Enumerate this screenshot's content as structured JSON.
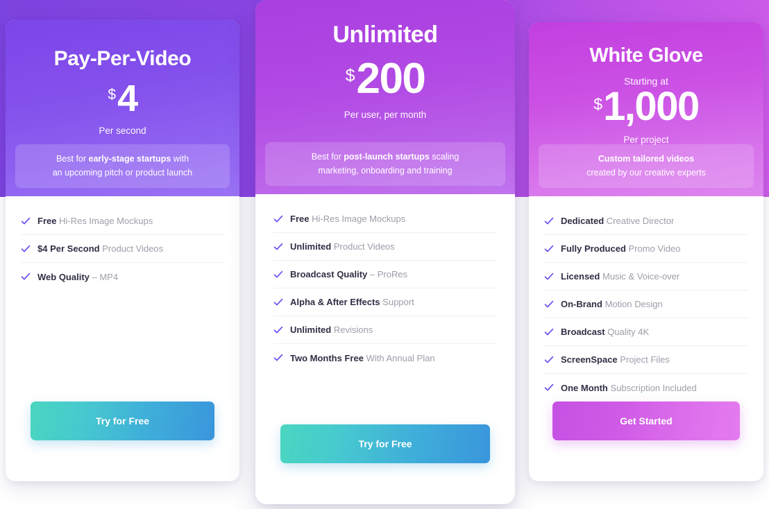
{
  "theme": {
    "band_color": "#8a45e2",
    "check_color": "#6c4bf0",
    "feature_strong_color": "#2f2f45",
    "feature_muted_color": "#9d9dab",
    "cta_teal_from": "#4ad6c0",
    "cta_teal_to": "#3a95dc",
    "cta_pink_from": "#c551e4",
    "cta_pink_to": "#e47bef"
  },
  "plans": [
    {
      "id": "pay-per-video",
      "name": "Pay-Per-Video",
      "starting_at": "",
      "currency": "$",
      "amount": "4",
      "price_sub": "Per second",
      "best_for_pre": "Best for ",
      "best_for_bold": "early-stage startups",
      "best_for_post": " with",
      "best_for_line2": "an upcoming pitch or product launch",
      "features": [
        {
          "strong": "Free",
          "rest": "Hi-Res Image Mockups"
        },
        {
          "strong": "$4 Per Second",
          "rest": "Product Videos"
        },
        {
          "strong": "Web Quality",
          "rest": "– MP4"
        }
      ],
      "cta_label": "Try for Free"
    },
    {
      "id": "unlimited",
      "name": "Unlimited",
      "starting_at": "",
      "currency": "$",
      "amount": "200",
      "price_sub": "Per user, per month",
      "best_for_pre": "Best for ",
      "best_for_bold": "post-launch startups",
      "best_for_post": " scaling",
      "best_for_line2": "marketing, onboarding and training",
      "features": [
        {
          "strong": "Free",
          "rest": "Hi-Res Image Mockups"
        },
        {
          "strong": "Unlimited",
          "rest": "Product Videos"
        },
        {
          "strong": "Broadcast Quality",
          "rest": "– ProRes"
        },
        {
          "strong": "Alpha & After Effects",
          "rest": "Support"
        },
        {
          "strong": "Unlimited",
          "rest": "Revisions"
        },
        {
          "strong": "Two Months Free",
          "rest": "With Annual Plan"
        }
      ],
      "cta_label": "Try for Free"
    },
    {
      "id": "white-glove",
      "name": "White Glove",
      "starting_at": "Starting at",
      "currency": "$",
      "amount": "1,000",
      "price_sub": "Per project",
      "best_for_pre": "",
      "best_for_bold": "Custom tailored videos",
      "best_for_post": "",
      "best_for_line2": "created by our creative experts",
      "features": [
        {
          "strong": "Dedicated",
          "rest": "Creative Director"
        },
        {
          "strong": "Fully Produced",
          "rest": "Promo Video"
        },
        {
          "strong": "Licensed",
          "rest": "Music & Voice-over"
        },
        {
          "strong": "On-Brand",
          "rest": "Motion Design"
        },
        {
          "strong": "Broadcast",
          "rest": "Quality 4K"
        },
        {
          "strong": "ScreenSpace",
          "rest": "Project Files"
        },
        {
          "strong": "One Month",
          "rest": "Subscription Included"
        }
      ],
      "cta_label": "Get Started"
    }
  ]
}
